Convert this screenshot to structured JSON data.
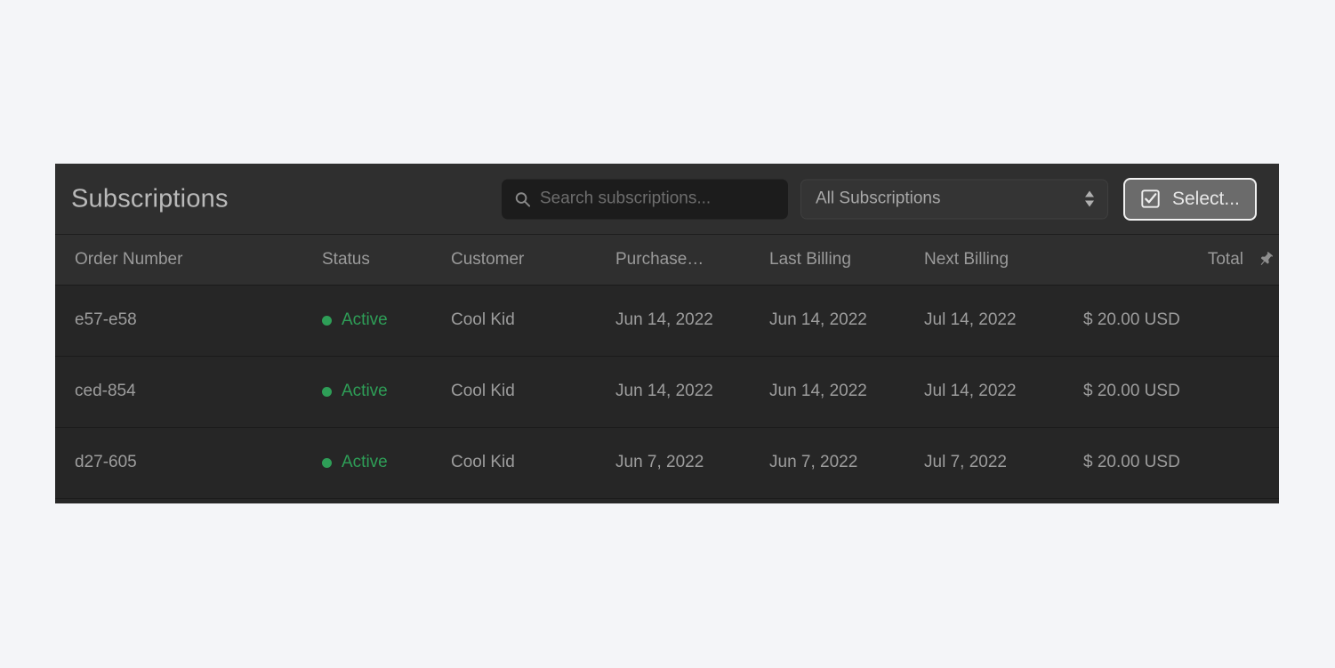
{
  "header": {
    "title": "Subscriptions",
    "search": {
      "placeholder": "Search subscriptions...",
      "value": "",
      "icon": "search-icon"
    },
    "filter_select": {
      "selected": "All Subscriptions",
      "options": [
        "All Subscriptions"
      ],
      "icon": "updown-chevron-icon"
    },
    "select_button": {
      "label": "Select...",
      "icon": "checkbox-checked-icon"
    }
  },
  "table": {
    "columns": [
      {
        "label": "Order Number",
        "key": "order_number"
      },
      {
        "label": "Status",
        "key": "status"
      },
      {
        "label": "Customer",
        "key": "customer"
      },
      {
        "label": "Purchase…",
        "key": "purchase_date"
      },
      {
        "label": "Last Billing",
        "key": "last_billing"
      },
      {
        "label": "Next Billing",
        "key": "next_billing"
      },
      {
        "label": "Total",
        "key": "total"
      },
      {
        "label": "",
        "key": "pin",
        "icon": "pushpin-icon"
      }
    ],
    "rows": [
      {
        "order_number": "e57-e58",
        "status": "Active",
        "customer": "Cool Kid",
        "purchase_date": "Jun 14, 2022",
        "last_billing": "Jun 14, 2022",
        "next_billing": "Jul 14, 2022",
        "total": "$ 20.00 USD"
      },
      {
        "order_number": "ced-854",
        "status": "Active",
        "customer": "Cool Kid",
        "purchase_date": "Jun 14, 2022",
        "last_billing": "Jun 14, 2022",
        "next_billing": "Jul 14, 2022",
        "total": "$ 20.00 USD"
      },
      {
        "order_number": "d27-605",
        "status": "Active",
        "customer": "Cool Kid",
        "purchase_date": "Jun 7, 2022",
        "last_billing": "Jun 7, 2022",
        "next_billing": "Jul 7, 2022",
        "total": "$ 20.00 USD"
      }
    ]
  },
  "colors": {
    "page_background": "#f4f5f8",
    "card_background": "#262626",
    "toolbar_background": "#2f2f2f",
    "status_active": "#2e9e57",
    "text_primary": "#b9b9b9",
    "text_secondary": "#9d9d9d",
    "button_background": "#6b6b6b",
    "button_border": "#f2f2f2"
  }
}
